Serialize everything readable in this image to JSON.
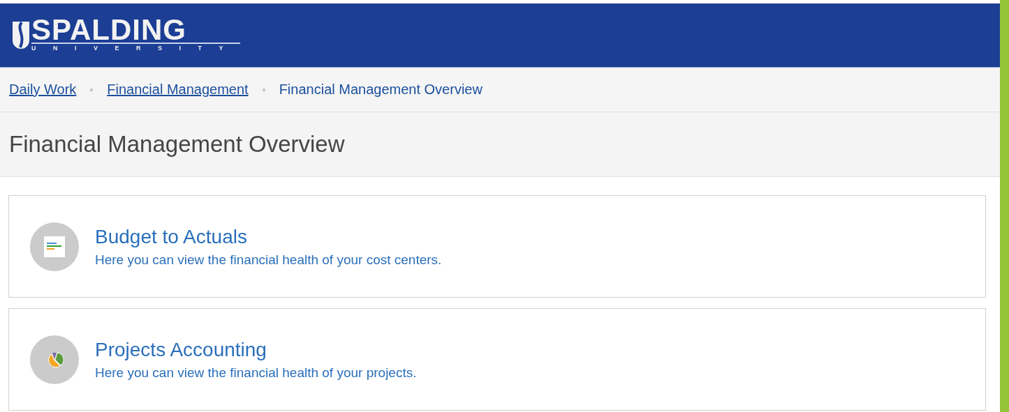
{
  "header": {
    "logo": {
      "name": "SPALDING",
      "subtitle": "UNIVERSITY"
    }
  },
  "breadcrumb": [
    {
      "label": "Daily Work",
      "kind": "link"
    },
    {
      "label": "Financial Management",
      "kind": "link"
    },
    {
      "label": "Financial Management Overview",
      "kind": "current"
    }
  ],
  "page_title": "Financial Management Overview",
  "cards": [
    {
      "title": "Budget to Actuals",
      "description": "Here you can view the financial health of your cost centers.",
      "kind": "report"
    },
    {
      "title": "Projects Accounting",
      "description": "Here you can view the financial health of your projects.",
      "kind": "pie"
    }
  ]
}
